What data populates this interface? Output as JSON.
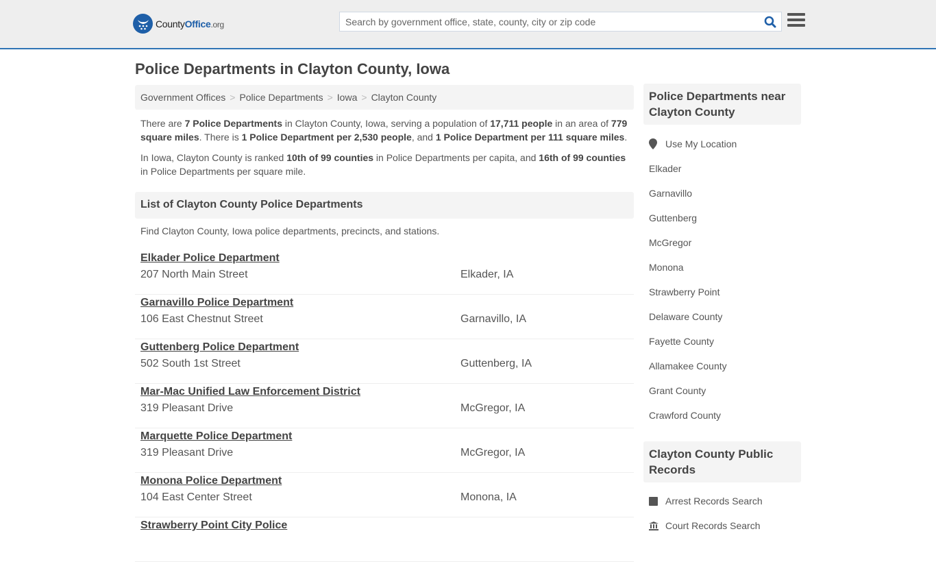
{
  "header": {
    "logo_main": "County",
    "logo_bold": "Office",
    "logo_tld": ".org",
    "search_placeholder": "Search by government office, state, county, city or zip code",
    "search_value": ""
  },
  "page_title": "Police Departments in Clayton County, Iowa",
  "breadcrumb": [
    "Government Offices",
    "Police Departments",
    "Iowa",
    "Clayton County"
  ],
  "breadcrumb_separator": ">",
  "intro": {
    "p1": [
      {
        "t": "There are ",
        "b": false
      },
      {
        "t": "7 Police Departments",
        "b": true
      },
      {
        "t": " in Clayton County, Iowa, serving a population of ",
        "b": false
      },
      {
        "t": "17,711 people",
        "b": true
      },
      {
        "t": " in an area of ",
        "b": false
      },
      {
        "t": "779 square miles",
        "b": true
      },
      {
        "t": ". There is ",
        "b": false
      },
      {
        "t": "1 Police Department per 2,530 people",
        "b": true
      },
      {
        "t": ", and ",
        "b": false
      },
      {
        "t": "1 Police Department per 111 square miles",
        "b": true
      },
      {
        "t": ".",
        "b": false
      }
    ],
    "p2": [
      {
        "t": "In Iowa, Clayton County is ranked ",
        "b": false
      },
      {
        "t": "10th of 99 counties",
        "b": true
      },
      {
        "t": " in Police Departments per capita, and ",
        "b": false
      },
      {
        "t": "16th of 99 counties",
        "b": true
      },
      {
        "t": " in Police Departments per square mile.",
        "b": false
      }
    ]
  },
  "list": {
    "heading": "List of Clayton County Police Departments",
    "description": "Find Clayton County, Iowa police departments, precincts, and stations.",
    "items": [
      {
        "name": "Elkader Police Department",
        "address": "207 North Main Street",
        "city": "Elkader, IA"
      },
      {
        "name": "Garnavillo Police Department",
        "address": "106 East Chestnut Street",
        "city": "Garnavillo, IA"
      },
      {
        "name": "Guttenberg Police Department",
        "address": "502 South 1st Street",
        "city": "Guttenberg, IA"
      },
      {
        "name": "Mar-Mac Unified Law Enforcement District",
        "address": "319 Pleasant Drive",
        "city": "McGregor, IA"
      },
      {
        "name": "Marquette Police Department",
        "address": "319 Pleasant Drive",
        "city": "McGregor, IA"
      },
      {
        "name": "Monona Police Department",
        "address": "104 East Center Street",
        "city": "Monona, IA"
      },
      {
        "name": "Strawberry Point City Police",
        "address": "",
        "city": ""
      }
    ]
  },
  "sidebar": {
    "nearby_heading": "Police Departments near Clayton County",
    "use_location": "Use My Location",
    "nearby_links": [
      "Elkader",
      "Garnavillo",
      "Guttenberg",
      "McGregor",
      "Monona",
      "Strawberry Point",
      "Delaware County",
      "Fayette County",
      "Allamakee County",
      "Grant County",
      "Crawford County"
    ],
    "records_heading": "Clayton County Public Records",
    "records_links": [
      {
        "label": "Arrest Records Search",
        "icon": "square-icon"
      },
      {
        "label": "Court Records Search",
        "icon": "courthouse-icon"
      }
    ]
  },
  "colors": {
    "brand_blue": "#1e5fa8",
    "accent_border": "#2f74b5",
    "text": "#555555"
  }
}
